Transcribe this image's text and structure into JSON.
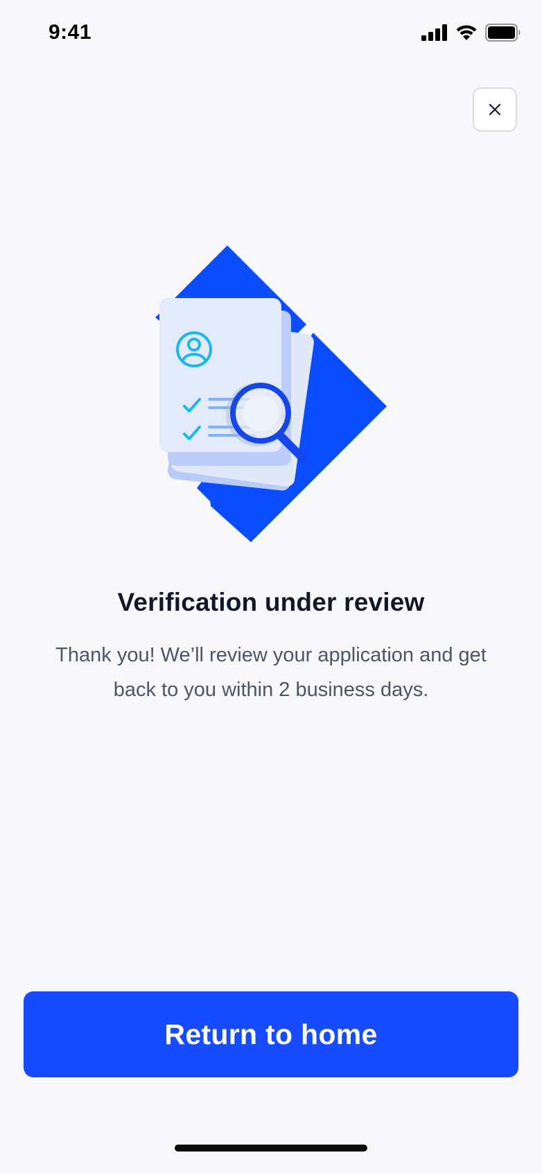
{
  "status_bar": {
    "time": "9:41"
  },
  "icons": {
    "signal": "cellular-signal-icon",
    "wifi": "wifi-icon",
    "battery": "battery-icon",
    "close": "close-icon",
    "illustration": "document-review-illustration"
  },
  "content": {
    "title": "Verification under review",
    "description": "Thank you! We’ll review your application and get back to you within 2 business days."
  },
  "actions": {
    "primary_label": "Return to home"
  },
  "colors": {
    "accent": "#174BFF",
    "background": "#F8F8FA",
    "title": "#111827",
    "body": "#4B5563",
    "icon_cyan": "#1BB8EE"
  }
}
